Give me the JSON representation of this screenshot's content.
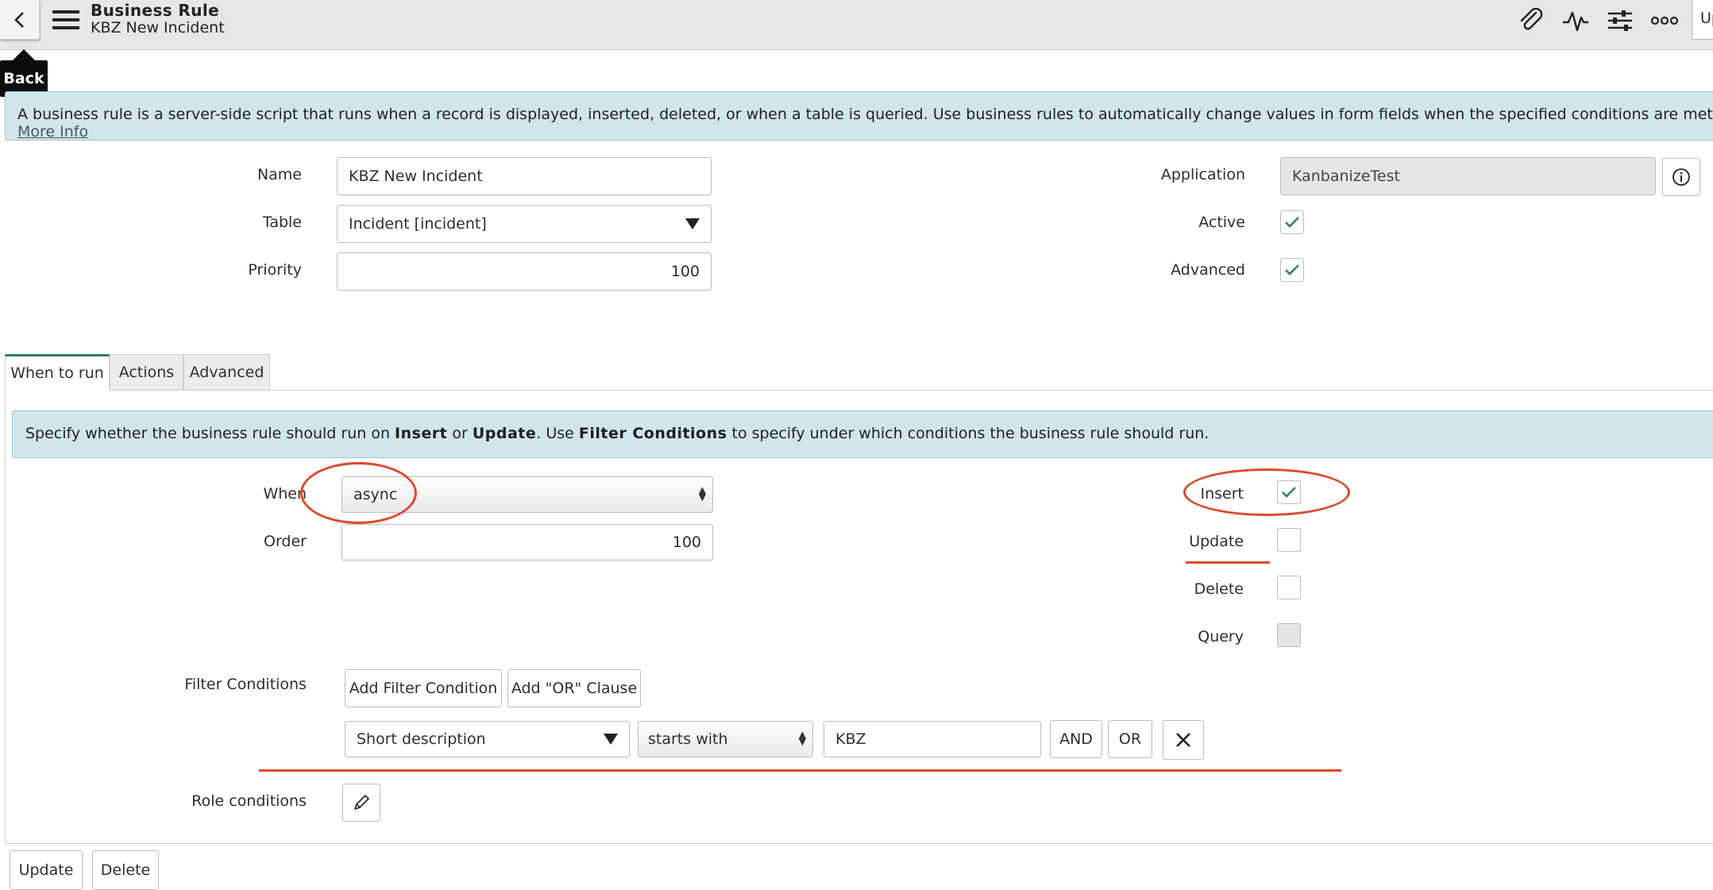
{
  "header": {
    "record_type": "Business Rule",
    "record_name": "KBZ New Incident",
    "back_tooltip": "Back",
    "update_fragment": "Up",
    "icons": [
      "back-chevron-icon",
      "hamburger-menu-icon",
      "paperclip-icon",
      "activity-pulse-icon",
      "sliders-icon",
      "more-options-icon"
    ]
  },
  "info_banner": {
    "text": "A business rule is a server-side script that runs when a record is displayed, inserted, deleted, or when a table is queried. Use business rules to automatically change values in form fields when the specified conditions are met.",
    "link": "More Info"
  },
  "form": {
    "name_label": "Name",
    "name_value": "KBZ New Incident",
    "table_label": "Table",
    "table_value": "Incident [incident]",
    "priority_label": "Priority",
    "priority_value": "100",
    "application_label": "Application",
    "application_value": "KanbanizeTest",
    "active_label": "Active",
    "active_checked": true,
    "advanced_label": "Advanced",
    "advanced_checked": true
  },
  "tabs": [
    {
      "label": "When to run",
      "active": true
    },
    {
      "label": "Actions",
      "active": false
    },
    {
      "label": "Advanced",
      "active": false
    }
  ],
  "when_to_run": {
    "banner": {
      "p1": "Specify whether the business rule should run on ",
      "b1": "Insert",
      "p2": " or ",
      "b2": "Update",
      "p3": ". Use ",
      "b3": "Filter Conditions",
      "p4": " to specify under which conditions the business rule should run."
    },
    "when_label": "When",
    "when_value": "async",
    "order_label": "Order",
    "order_value": "100",
    "insert_label": "Insert",
    "insert_checked": true,
    "update_label": "Update",
    "update_checked": false,
    "delete_label": "Delete",
    "delete_checked": false,
    "query_label": "Query",
    "query_checked": false,
    "filter_label": "Filter Conditions",
    "add_filter_button": "Add Filter Condition",
    "add_or_button": "Add \"OR\" Clause",
    "condition": {
      "field": "Short description",
      "operator": "starts with",
      "value": "KBZ",
      "and_button": "AND",
      "or_button": "OR"
    },
    "role_label": "Role conditions"
  },
  "footer": {
    "update_button": "Update",
    "delete_button": "Delete"
  },
  "colors": {
    "accent_check": "#2f7f6a",
    "banner_bg": "#d0e6ec",
    "annotation_red": "#dd4a2e"
  }
}
